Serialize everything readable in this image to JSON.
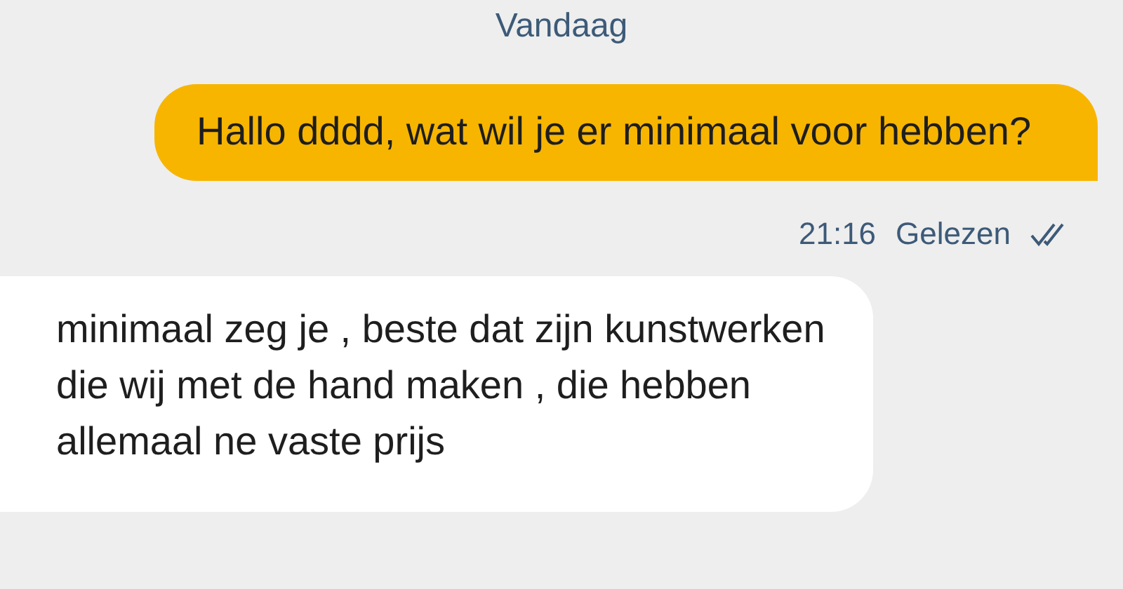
{
  "date_separator": "Vandaag",
  "messages": [
    {
      "kind": "outgoing",
      "text": "Hallo dddd, wat wil je er minimaal voor hebben?",
      "time": "21:16",
      "status": "Gelezen"
    },
    {
      "kind": "incoming",
      "text": "minimaal zeg je , beste dat zijn kunstwerken die wij met de hand maken , die hebben allemaal ne vaste prijs"
    }
  ]
}
